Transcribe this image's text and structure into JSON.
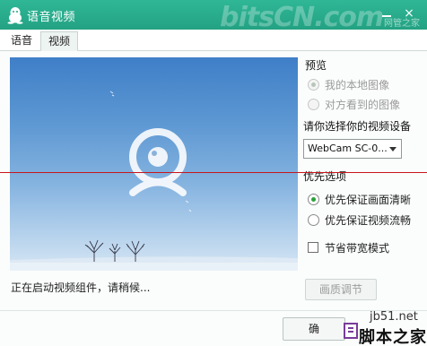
{
  "window": {
    "title": "语音视频",
    "watermark_logo_text": "bitsCN.com",
    "watermark_logo_sub": "网管之家",
    "close_glyph": "×"
  },
  "tabs": [
    {
      "label": "语音",
      "selected": false
    },
    {
      "label": "视频",
      "selected": true
    }
  ],
  "video": {
    "status_text": "正在启动视频组件，请稍候..."
  },
  "preview": {
    "label": "预览",
    "options": [
      {
        "label": "我的本地图像",
        "checked": true,
        "disabled": true
      },
      {
        "label": "对方看到的图像",
        "checked": false,
        "disabled": true
      }
    ]
  },
  "device": {
    "label": "请你选择你的视频设备",
    "selected_value": "WebCam SC-0..."
  },
  "priority": {
    "label": "优先选项",
    "options": [
      {
        "label": "优先保证画面清晰",
        "checked": true
      },
      {
        "label": "优先保证视频流畅",
        "checked": false
      }
    ],
    "bandwidth_saving_label": "节省带宽模式",
    "bandwidth_saving_checked": false
  },
  "buttons": {
    "quality_adjust": "画质调节",
    "bottom_partial": "确"
  },
  "watermark": {
    "site": "jb51.net",
    "brand": "脚本之家"
  },
  "colors": {
    "titlebar": "#23a283",
    "radio_checked": "#2aa13a",
    "annotation_line": "#c8161d"
  }
}
